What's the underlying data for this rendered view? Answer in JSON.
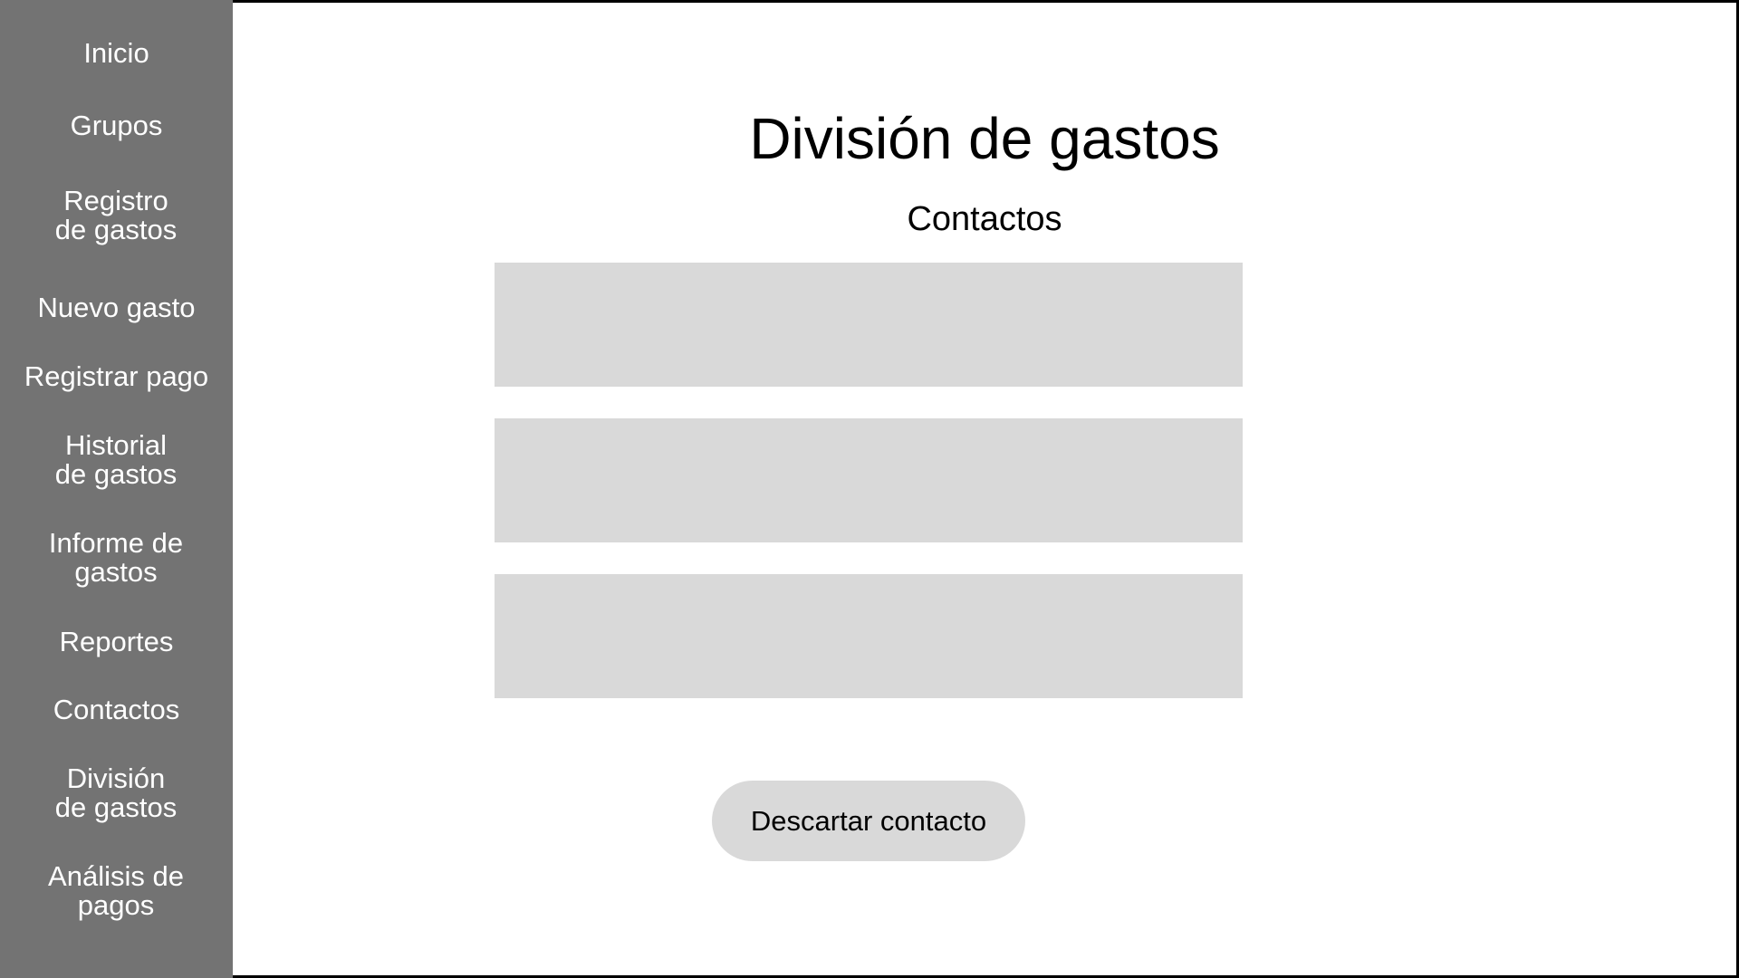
{
  "sidebar": {
    "background": "#737373",
    "items": [
      {
        "label": "Inicio"
      },
      {
        "label": "Grupos"
      },
      {
        "label": "Registro de gastos"
      },
      {
        "label": "Nuevo gasto"
      },
      {
        "label": "Registrar pago"
      },
      {
        "label": "Historial de gastos"
      },
      {
        "label": "Informe de gastos"
      },
      {
        "label": "Reportes"
      },
      {
        "label": "Contactos"
      },
      {
        "label": "División de gastos"
      },
      {
        "label": "Análisis de pagos"
      }
    ]
  },
  "main": {
    "title": "División de gastos",
    "section_title": "Contactos",
    "contact_card_color": "#d9d9d9",
    "discard_button_label": "Descartar contacto"
  }
}
